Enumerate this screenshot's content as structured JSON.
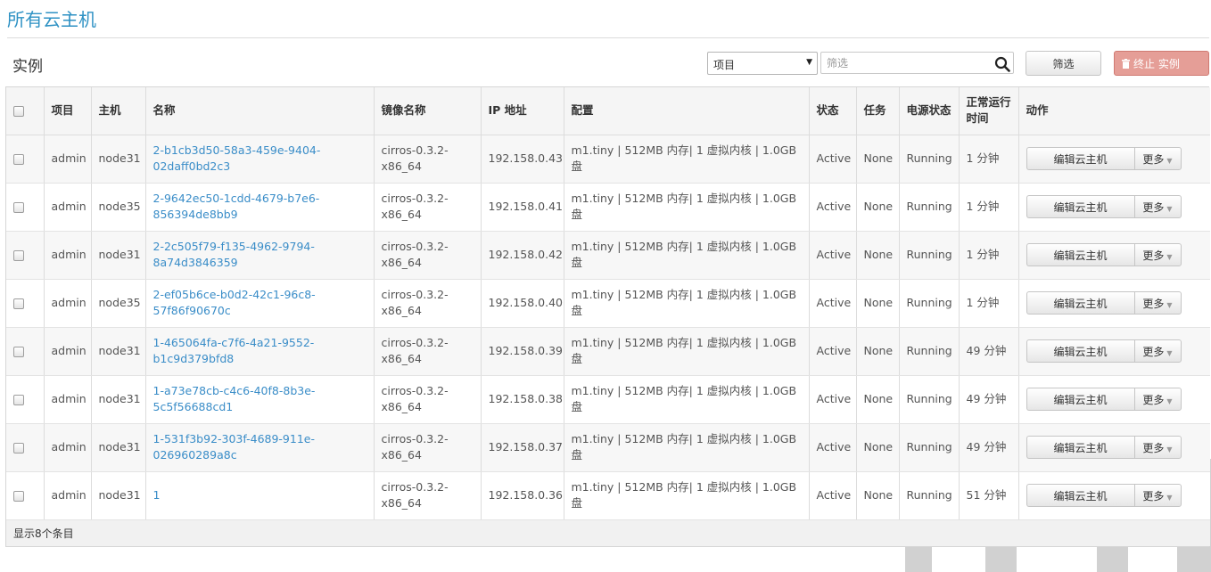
{
  "page": {
    "title": "所有云主机"
  },
  "toolbar": {
    "section_title": "实例",
    "select_value": "项目",
    "filter_placeholder": "筛选",
    "filter_button": "筛选",
    "terminate_button": "终止 实例"
  },
  "table": {
    "columns": [
      "项目",
      "主机",
      "名称",
      "镜像名称",
      "IP 地址",
      "配置",
      "状态",
      "任务",
      "电源状态",
      "正常运行时间",
      "动作"
    ],
    "rows": [
      {
        "project": "admin",
        "host": "node31",
        "name": "2-b1cb3d50-58a3-459e-9404-02daff0bd2c3",
        "image": "cirros-0.3.2-x86_64",
        "ip": "192.158.0.43",
        "config": "m1.tiny | 512MB 内存| 1 虚拟内核 | 1.0GB 盘",
        "status": "Active",
        "task": "None",
        "power": "Running",
        "uptime": "1 分钟"
      },
      {
        "project": "admin",
        "host": "node35",
        "name": "2-9642ec50-1cdd-4679-b7e6-856394de8bb9",
        "image": "cirros-0.3.2-x86_64",
        "ip": "192.158.0.41",
        "config": "m1.tiny | 512MB 内存| 1 虚拟内核 | 1.0GB 盘",
        "status": "Active",
        "task": "None",
        "power": "Running",
        "uptime": "1 分钟"
      },
      {
        "project": "admin",
        "host": "node31",
        "name": "2-2c505f79-f135-4962-9794-8a74d3846359",
        "image": "cirros-0.3.2-x86_64",
        "ip": "192.158.0.42",
        "config": "m1.tiny | 512MB 内存| 1 虚拟内核 | 1.0GB 盘",
        "status": "Active",
        "task": "None",
        "power": "Running",
        "uptime": "1 分钟"
      },
      {
        "project": "admin",
        "host": "node35",
        "name": "2-ef05b6ce-b0d2-42c1-96c8-57f86f90670c",
        "image": "cirros-0.3.2-x86_64",
        "ip": "192.158.0.40",
        "config": "m1.tiny | 512MB 内存| 1 虚拟内核 | 1.0GB 盘",
        "status": "Active",
        "task": "None",
        "power": "Running",
        "uptime": "1 分钟"
      },
      {
        "project": "admin",
        "host": "node31",
        "name": "1-465064fa-c7f6-4a21-9552-b1c9d379bfd8",
        "image": "cirros-0.3.2-x86_64",
        "ip": "192.158.0.39",
        "config": "m1.tiny | 512MB 内存| 1 虚拟内核 | 1.0GB 盘",
        "status": "Active",
        "task": "None",
        "power": "Running",
        "uptime": "49 分钟"
      },
      {
        "project": "admin",
        "host": "node31",
        "name": "1-a73e78cb-c4c6-40f8-8b3e-5c5f56688cd1",
        "image": "cirros-0.3.2-x86_64",
        "ip": "192.158.0.38",
        "config": "m1.tiny | 512MB 内存| 1 虚拟内核 | 1.0GB 盘",
        "status": "Active",
        "task": "None",
        "power": "Running",
        "uptime": "49 分钟"
      },
      {
        "project": "admin",
        "host": "node31",
        "name": "1-531f3b92-303f-4689-911e-026960289a8c",
        "image": "cirros-0.3.2-x86_64",
        "ip": "192.158.0.37",
        "config": "m1.tiny | 512MB 内存| 1 虚拟内核 | 1.0GB 盘",
        "status": "Active",
        "task": "None",
        "power": "Running",
        "uptime": "49 分钟"
      },
      {
        "project": "admin",
        "host": "node31",
        "name": "1",
        "image": "cirros-0.3.2-x86_64",
        "ip": "192.158.0.36",
        "config": "m1.tiny | 512MB 内存| 1 虚拟内核 | 1.0GB 盘",
        "status": "Active",
        "task": "None",
        "power": "Running",
        "uptime": "51 分钟"
      }
    ],
    "row_actions": {
      "edit": "编辑云主机",
      "more": "更多"
    },
    "footer": "显示8个条目"
  },
  "icons": {
    "search": "search-icon",
    "trash": "trash-icon",
    "caret": "caret-down-icon",
    "watermark": "logo-watermark"
  },
  "colors": {
    "title": "#2f92c4",
    "link": "#3a8dc8",
    "danger": "#e59e97"
  }
}
